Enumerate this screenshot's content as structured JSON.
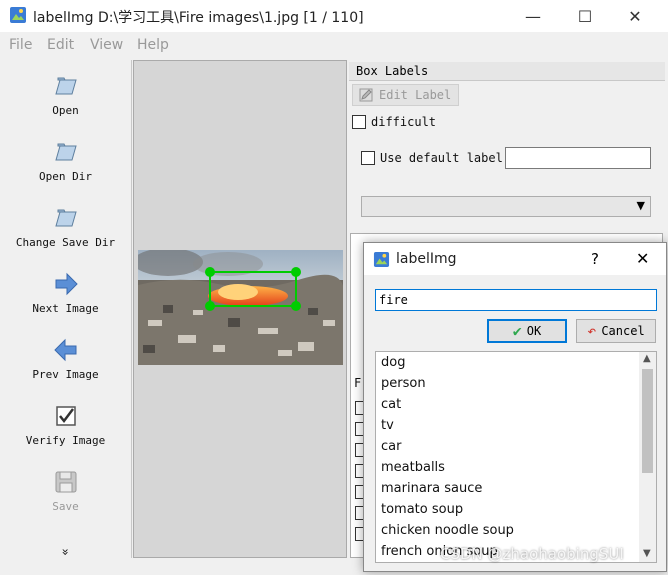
{
  "window": {
    "title": "labelImg D:\\学习工具\\Fire images\\1.jpg [1 / 110]",
    "minimize": "—",
    "maximize": "☐",
    "close": "✕"
  },
  "menu": [
    "File",
    "Edit",
    "View",
    "Help"
  ],
  "toolbar": [
    {
      "label": "Open",
      "icon": "folder-icon"
    },
    {
      "label": "Open Dir",
      "icon": "folder-icon"
    },
    {
      "label": "Change Save Dir",
      "icon": "folder-icon"
    },
    {
      "label": "Next Image",
      "icon": "arrow-right-icon"
    },
    {
      "label": "Prev Image",
      "icon": "arrow-left-icon"
    },
    {
      "label": "Verify Image",
      "icon": "checkbox-icon"
    },
    {
      "label": "Save",
      "icon": "floppy-icon"
    }
  ],
  "toolbar_more": "»",
  "panel": {
    "header": "Box Labels",
    "edit_label": "Edit Label",
    "difficult": "difficult",
    "use_default_label": "Use default label",
    "default_label_value": "",
    "file_list_header": "F"
  },
  "dialog": {
    "title": "labelImg",
    "help": "?",
    "close": "✕",
    "input_value": "fire",
    "ok": "OK",
    "cancel": "Cancel",
    "items": [
      "dog",
      "person",
      "cat",
      "tv",
      "car",
      "meatballs",
      "marinara sauce",
      "tomato soup",
      "chicken noodle soup",
      "french onion soup"
    ]
  },
  "watermark": "CSDN @zhaohaobingSUI",
  "colors": {
    "bbox": "#00cc00",
    "accent": "#0078d7"
  }
}
